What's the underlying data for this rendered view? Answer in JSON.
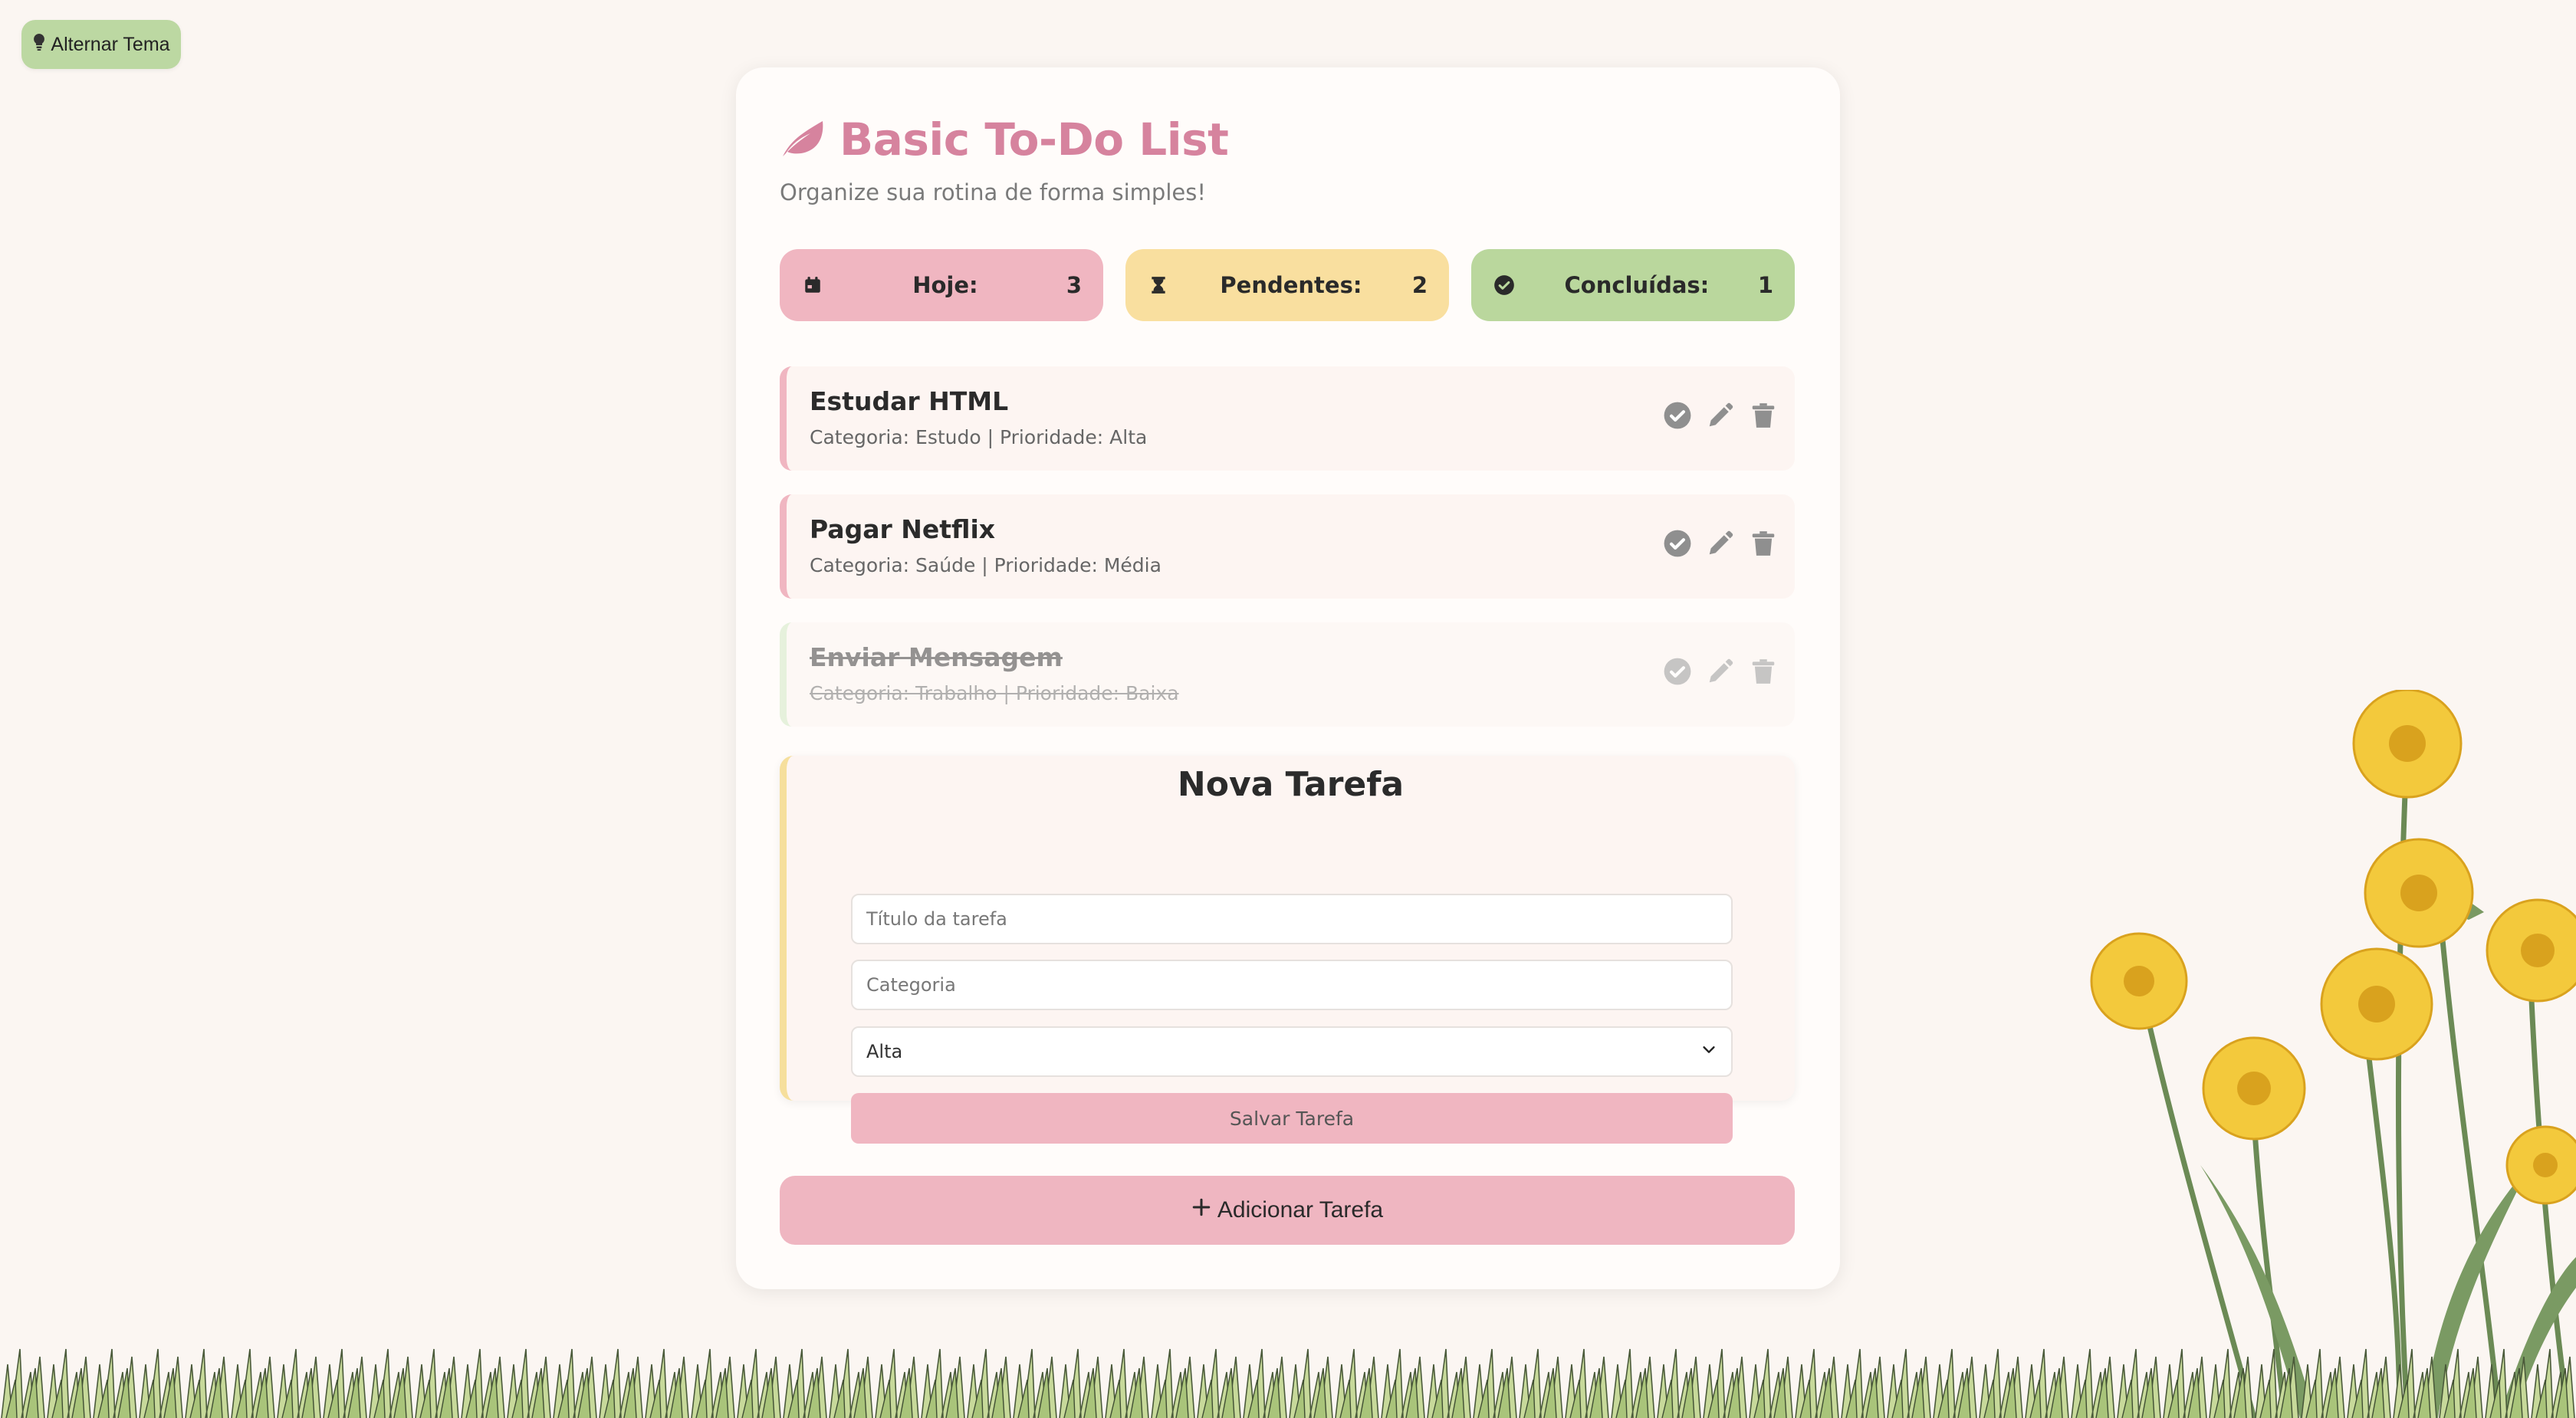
{
  "theme_toggle": {
    "label": "Alternar Tema",
    "icon": "lightbulb-icon"
  },
  "app": {
    "title": "Basic To-Do List",
    "subtitle": "Organize sua rotina de forma simples!",
    "logo_icon": "leaf-icon"
  },
  "stats": [
    {
      "label": "Hoje:",
      "value": "3",
      "icon": "calendar-icon",
      "color": "#f0b6c1"
    },
    {
      "label": "Pendentes:",
      "value": "2",
      "icon": "hourglass-icon",
      "color": "#f9df9f"
    },
    {
      "label": "Concluídas:",
      "value": "1",
      "icon": "check-circle-icon",
      "color": "#bad79d"
    }
  ],
  "tasks": [
    {
      "title": "Estudar HTML",
      "meta": "Categoria: Estudo | Prioridade: Alta",
      "done": false
    },
    {
      "title": "Pagar Netflix",
      "meta": "Categoria: Saúde | Prioridade: Média",
      "done": false
    },
    {
      "title": "Enviar Mensagem",
      "meta": "Categoria: Trabalho | Prioridade: Baixa",
      "done": true
    }
  ],
  "form": {
    "title": "Nova Tarefa",
    "title_placeholder": "Título da tarefa",
    "category_placeholder": "Categoria",
    "priority_selected": "Alta",
    "save_label": "Salvar Tarefa"
  },
  "add_button": {
    "label": "Adicionar Tarefa",
    "icon": "plus-icon"
  },
  "colors": {
    "background": "#fbf6f2",
    "accent_pink": "#d6839e",
    "card": "#fffcfa"
  }
}
